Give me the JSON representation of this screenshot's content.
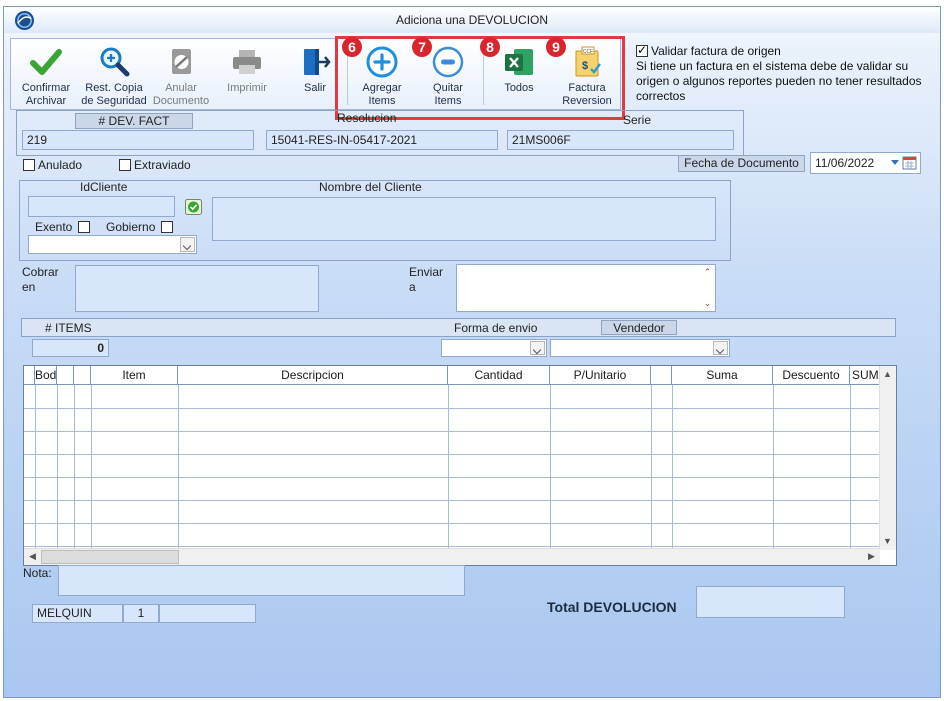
{
  "window": {
    "title": "Adiciona una DEVOLUCION"
  },
  "toolbar": {
    "confirm_l1": "Confirmar",
    "confirm_l2": "Archivar",
    "backup_l1": "Rest. Copia",
    "backup_l2": "de Seguridad",
    "void_l1": "Anular",
    "void_l2": "Documento",
    "print": "Imprimir",
    "exit": "Salir",
    "add_l1": "Agregar",
    "add_l2": "Items",
    "remove_l1": "Quitar",
    "remove_l2": "Items",
    "all": "Todos",
    "rev_l1": "Factura",
    "rev_l2": "Reversion"
  },
  "badges": {
    "b6": "6",
    "b7": "7",
    "b8": "8",
    "b9": "9"
  },
  "validate": {
    "label": "Validar factura de origen",
    "checked": true,
    "note": "Si tiene un factura en el sistema debe de validar su origen o algunos reportes pueden no tener resultados correctos"
  },
  "header": {
    "dev_label": "# DEV. FACT",
    "dev_value": "219",
    "resolution_label": "Resolucion",
    "resolution_value": "15041-RES-IN-05417-2021",
    "serie_label": "Serie",
    "serie_value": "21MS006F",
    "anulado": "Anulado",
    "extraviado": "Extraviado",
    "fecha_label": "Fecha de  Documento",
    "fecha_value": "11/06/2022"
  },
  "client": {
    "id_label": "IdCliente",
    "id_value": "",
    "name_label": "Nombre del Cliente",
    "name_value": "",
    "exento": "Exento",
    "gobierno": "Gobierno",
    "cobrar_l1": "Cobrar",
    "cobrar_l2": "en",
    "enviar_l1": "Enviar",
    "enviar_l2": "a"
  },
  "items_bar": {
    "items_label": "# ITEMS",
    "items_count": "0",
    "forma_envio": "Forma de envio",
    "vendedor": "Vendedor"
  },
  "grid": {
    "columns": [
      "Bodega",
      "",
      "",
      "Item",
      "Descripcion",
      "Cantidad",
      "P/Unitario",
      "",
      "Suma",
      "Descuento",
      "SUMA"
    ]
  },
  "footer": {
    "nota_label": "Nota:",
    "nota_value": "",
    "user": "MELQUIN",
    "station": "1",
    "extra": "",
    "total_label": "Total DEVOLUCION",
    "total_value": ""
  },
  "colors": {
    "accent_red": "#e53941",
    "badge_red": "#d9262e",
    "field_blue": "#d7e6fa",
    "excel_green": "#1f7244"
  }
}
